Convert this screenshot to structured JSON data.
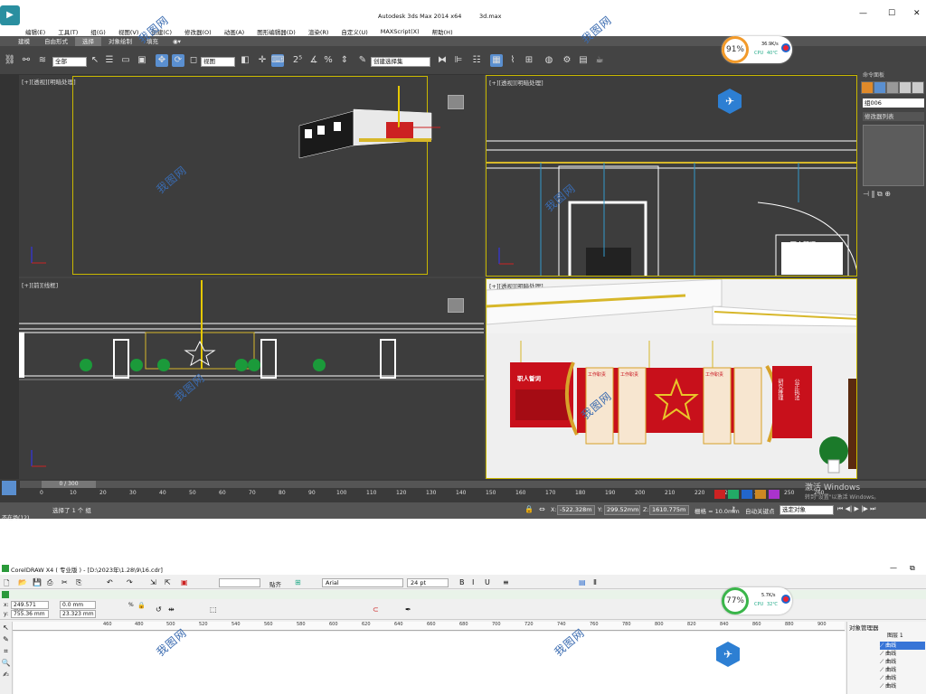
{
  "max": {
    "title": "Autodesk 3ds Max  2014 x64",
    "filename": "3d.max",
    "menu": [
      "编辑(E)",
      "工具(T)",
      "组(G)",
      "视图(V)",
      "创建(C)",
      "修改器(O)",
      "动画(A)",
      "图形编辑器(D)",
      "渲染(R)",
      "自定义(U)",
      "MAXScript(X)",
      "帮助(H)"
    ],
    "ribbon_tabs": [
      "建模",
      "自由形式",
      "选择",
      "对象绘制",
      "填充"
    ],
    "toolbar": {
      "filter": "全部",
      "ref_coord": "视图",
      "sel_set": "创建选择集"
    },
    "viewports": {
      "top_left": "[+][透视][明暗处理]",
      "top_right": "[+][透视][明暗处理]",
      "bottom_left": "[+][前][线框]",
      "bottom_right": "[+][透视][明暗处理]"
    },
    "signboard": {
      "title1": "职人誓词",
      "title2": "职人誓词",
      "sub1": "研究推理",
      "sub2": "公正执法",
      "panel1": "工作职责",
      "panel2": "工作职责",
      "panel3": "工作职责"
    },
    "cmdpanel": {
      "title": "命令面板",
      "object_name": "组006",
      "modifier_list": "修改器列表"
    },
    "timeline": {
      "frame": "0 / 300",
      "ticks": [
        "0",
        "10",
        "20",
        "30",
        "40",
        "50",
        "60",
        "70",
        "80",
        "90",
        "100",
        "110",
        "120",
        "130",
        "140",
        "150",
        "160",
        "170",
        "180",
        "190",
        "200",
        "210",
        "220",
        "230",
        "240",
        "250",
        "260"
      ]
    },
    "status": {
      "left_cut": "不在场(12)",
      "message": "选择了 1 个 组",
      "x_label": "X:",
      "x": "-522.328m",
      "y_label": "Y:",
      "y": "299.52mm",
      "z_label": "Z:",
      "z": "1610.775m",
      "grid": "栅格 = 10.0mm",
      "autokey": "自动关键点",
      "selected": "选定对象"
    },
    "activate": {
      "line1": "激活 Windows",
      "line2": "转到\"设置\"以激活 Windows。"
    }
  },
  "monitor1": {
    "percent": "91%",
    "speed": "36.9K/s",
    "cpu_label": "CPU",
    "cpu_temp": "40℃",
    "ring_color": "#f29a2a"
  },
  "monitor2": {
    "percent": "77%",
    "speed": "5.7K/s",
    "cpu_label": "CPU",
    "cpu_temp": "32℃",
    "ring_color": "#3ab54a"
  },
  "corel": {
    "title": "CorelDRAW X4 ( 专业版 ) - [D:\\2023年\\1.28\\9\\16.cdr]",
    "snap": "贴齐",
    "font": "Arial",
    "size": "24 pt",
    "x": "249.571 mm",
    "y": "755.36 mm",
    "w": "0.0 mm",
    "h": "23.323 mm",
    "ruler": [
      "460",
      "480",
      "500",
      "520",
      "540",
      "560",
      "580",
      "600",
      "620",
      "640",
      "660",
      "680",
      "700",
      "720",
      "740",
      "760",
      "780",
      "800",
      "820",
      "840",
      "860",
      "880",
      "900"
    ],
    "objmgr": {
      "title": "对象管理器",
      "layer": "图层 1",
      "items": [
        "曲线",
        "曲线",
        "曲线",
        "曲线",
        "曲线",
        "曲线"
      ]
    }
  },
  "watermark": "我图网"
}
